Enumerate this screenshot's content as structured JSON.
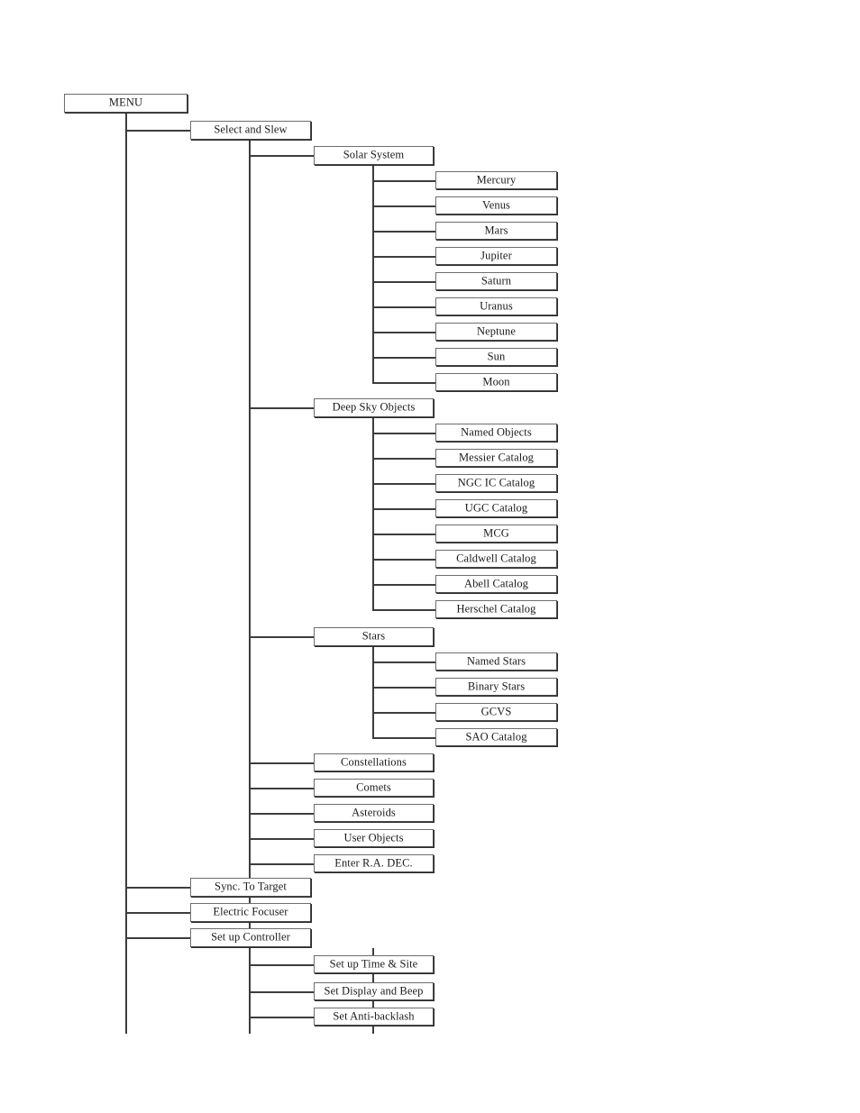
{
  "diagram": {
    "title": "MENU",
    "type": "hand-controller-menu-tree",
    "root": {
      "label": "MENU"
    },
    "nodes": {
      "menu": "MENU",
      "select_and_slew": "Select and Slew",
      "solar_system": "Solar System",
      "mercury": "Mercury",
      "venus": "Venus",
      "mars": "Mars",
      "jupiter": "Jupiter",
      "saturn": "Saturn",
      "uranus": "Uranus",
      "neptune": "Neptune",
      "sun": "Sun",
      "moon": "Moon",
      "deep_sky_objects": "Deep Sky Objects",
      "named_objects": "Named Objects",
      "messier_catalog": "Messier Catalog",
      "ngc_ic_catalog": "NGC IC Catalog",
      "ugc_catalog": "UGC Catalog",
      "mcg": "MCG",
      "caldwell_catalog": "Caldwell Catalog",
      "abell_catalog": "Abell Catalog",
      "herschel_catalog": "Herschel Catalog",
      "stars": "Stars",
      "named_stars": "Named Stars",
      "binary_stars": "Binary Stars",
      "gcvs": "GCVS",
      "sao_catalog": "SAO Catalog",
      "constellations": "Constellations",
      "comets": "Comets",
      "asteroids": "Asteroids",
      "user_objects": "User Objects",
      "enter_ra_dec": "Enter R.A. DEC.",
      "sync_to_target": "Sync.  To Target",
      "electric_focuser": "Electric Focuser",
      "set_up_controller": "Set up Controller",
      "set_up_time_site": "Set up Time & Site",
      "set_display_and_beep": "Set Display and Beep",
      "set_anti_backlash": "Set Anti-backlash"
    },
    "colors": {
      "line": "#3d3d3d",
      "border": "#4a4a4a",
      "shadow": "#2b2b2b",
      "text": "#1a1a1a",
      "background": "#ffffff"
    }
  }
}
